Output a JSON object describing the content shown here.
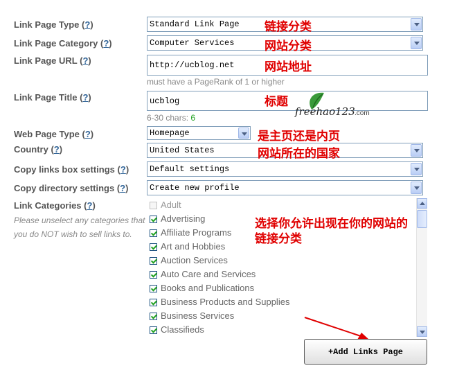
{
  "help_text": "?",
  "fields": {
    "link_page_type": {
      "label": "Link Page Type",
      "value": "Standard Link Page"
    },
    "link_page_category": {
      "label": "Link Page Category",
      "value": "Computer Services"
    },
    "link_page_url": {
      "label": "Link Page URL",
      "value": "http://ucblog.net",
      "hint": "must have a PageRank of 1 or higher"
    },
    "link_page_title": {
      "label": "Link Page Title",
      "value": "ucblog",
      "hint_prefix": "6-30 chars:",
      "hint_count": "6"
    },
    "web_page_type": {
      "label": "Web Page Type",
      "value": "Homepage"
    },
    "country": {
      "label": "Country",
      "value": "United States"
    },
    "copy_links_box": {
      "label": "Copy links box settings",
      "value": "Default settings"
    },
    "copy_directory": {
      "label": "Copy directory settings",
      "value": "Create new profile"
    },
    "link_categories": {
      "label": "Link Categories",
      "note": "Please unselect any categories that you do NOT wish to sell links to."
    }
  },
  "categories": [
    {
      "label": "Adult",
      "checked": false
    },
    {
      "label": "Advertising",
      "checked": true
    },
    {
      "label": "Affiliate Programs",
      "checked": true
    },
    {
      "label": "Art and Hobbies",
      "checked": true
    },
    {
      "label": "Auction Services",
      "checked": true
    },
    {
      "label": "Auto Care and Services",
      "checked": true
    },
    {
      "label": "Books and Publications",
      "checked": true
    },
    {
      "label": "Business Products and Supplies",
      "checked": true
    },
    {
      "label": "Business Services",
      "checked": true
    },
    {
      "label": "Classifieds",
      "checked": true
    }
  ],
  "annotations": {
    "type": "链接分类",
    "category": "网站分类",
    "url": "网站地址",
    "title": "标题",
    "webpage": "是主页还是内页",
    "country": "网站所在的国家",
    "categories": "选择你允许出现在你的网站的\n链接分类"
  },
  "watermark": {
    "text": "freehao123",
    "suffix": ".com"
  },
  "add_button": "+Add Links Page",
  "colors": {
    "annotation": "#e00000",
    "count": "#21a121",
    "help_link": "#336699"
  }
}
